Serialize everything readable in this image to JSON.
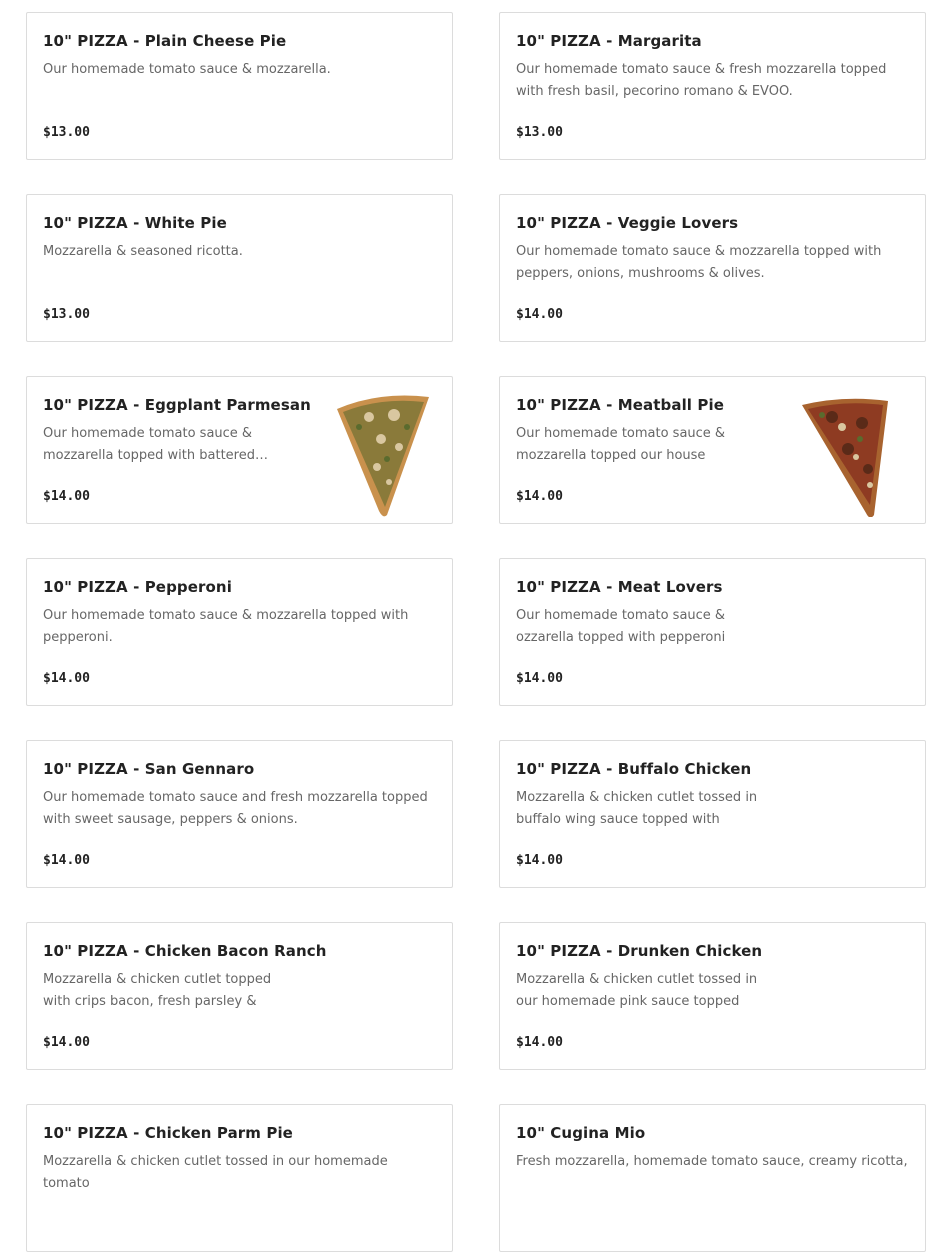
{
  "menu": {
    "items": [
      {
        "title": "10\" PIZZA - Plain Cheese Pie",
        "description": "Our homemade tomato sauce & mozzarella.",
        "price": "$13.00"
      },
      {
        "title": "10\" PIZZA - Margarita",
        "description": "Our homemade tomato sauce & fresh mozzarella topped with fresh basil, pecorino romano & EVOO.",
        "price": "$13.00"
      },
      {
        "title": "10\" PIZZA - White Pie",
        "description": "Mozzarella & seasoned ricotta.",
        "price": "$13.00"
      },
      {
        "title": "10\" PIZZA - Veggie Lovers",
        "description": "Our homemade tomato sauce & mozzarella topped with peppers, onions, mushrooms & olives.",
        "price": "$14.00"
      },
      {
        "title": "10\" PIZZA - Eggplant Parmesan",
        "description": "Our homemade tomato sauce & mozzarella topped with battered…",
        "price": "$14.00",
        "image": "pizza-slice-eggplant"
      },
      {
        "title": "10\" PIZZA - Meatball Pie",
        "description": "Our homemade tomato sauce & mozzarella topped our house made all…",
        "price": "$14.00",
        "image": "pizza-slice-meatball"
      },
      {
        "title": "10\" PIZZA - Pepperoni",
        "description": "Our homemade tomato sauce & mozzarella topped with pepperoni.",
        "price": "$14.00"
      },
      {
        "title": "10\" PIZZA - Meat Lovers",
        "description": "Our homemade tomato sauce & ozzarella topped with pepperoni &…",
        "price": "$14.00"
      },
      {
        "title": "10\" PIZZA - San Gennaro",
        "description": "Our homemade tomato sauce and fresh mozzarella topped with sweet sausage, peppers & onions.",
        "price": "$14.00"
      },
      {
        "title": "10\" PIZZA - Buffalo Chicken",
        "description": "Mozzarella & chicken cutlet tossed in buffalo wing sauce topped with fresh…",
        "price": "$14.00"
      },
      {
        "title": "10\" PIZZA - Chicken Bacon Ranch",
        "description": "Mozzarella & chicken cutlet topped with crips bacon, fresh parsley & ranc…",
        "price": "$14.00"
      },
      {
        "title": "10\" PIZZA - Drunken Chicken",
        "description": "Mozzarella & chicken cutlet tossed in our homemade pink sauce topped wit…",
        "price": "$14.00"
      },
      {
        "title": "10\" PIZZA - Chicken Parm Pie",
        "description": "Mozzarella & chicken cutlet tossed in our homemade tomato",
        "price": ""
      },
      {
        "title": "10\" Cugina Mio",
        "description": "Fresh mozzarella, homemade tomato sauce, creamy ricotta,",
        "price": ""
      }
    ]
  },
  "colors": {
    "crust": "#c9914d",
    "sauce_eggplant": "#8a7a3a",
    "sauce_meatball": "#8e3b22",
    "cheese": "#d9c7a0"
  }
}
